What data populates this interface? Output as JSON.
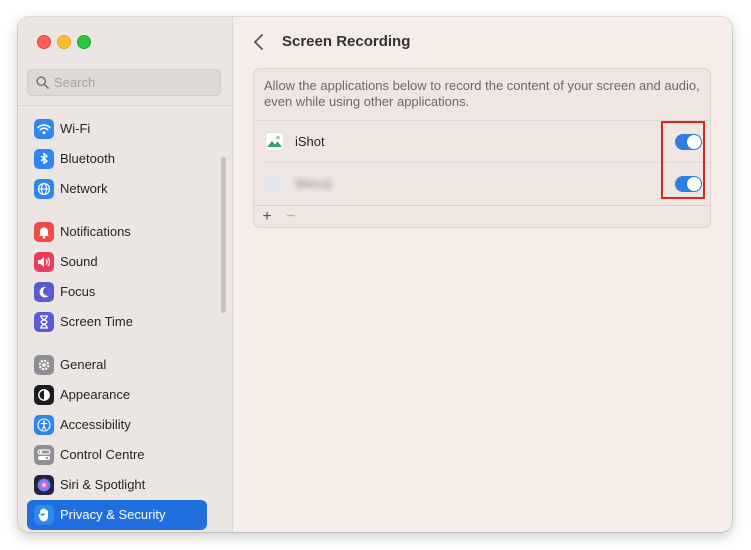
{
  "window": {
    "traffic_lights": [
      "close",
      "minimize",
      "maximize"
    ]
  },
  "search": {
    "placeholder": "Search"
  },
  "sidebar": {
    "items": [
      {
        "label": "Wi-Fi",
        "icon": "wifi-icon",
        "color": "#2f86ec"
      },
      {
        "label": "Bluetooth",
        "icon": "bluetooth-icon",
        "color": "#2f86ec"
      },
      {
        "label": "Network",
        "icon": "globe-icon",
        "color": "#2f86ec"
      },
      {
        "label": "Notifications",
        "icon": "bell-icon",
        "color": "#ef4a45"
      },
      {
        "label": "Sound",
        "icon": "speaker-icon",
        "color": "#ef3b5c"
      },
      {
        "label": "Focus",
        "icon": "moon-icon",
        "color": "#5b5bd6"
      },
      {
        "label": "Screen Time",
        "icon": "hourglass-icon",
        "color": "#5b5bd6"
      },
      {
        "label": "General",
        "icon": "gear-icon",
        "color": "#8e8e93"
      },
      {
        "label": "Appearance",
        "icon": "appearance-icon",
        "color": "#1c1c1e"
      },
      {
        "label": "Accessibility",
        "icon": "accessibility-icon",
        "color": "#2f86ec"
      },
      {
        "label": "Control Centre",
        "icon": "control-centre-icon",
        "color": "#8e8e93"
      },
      {
        "label": "Siri & Spotlight",
        "icon": "siri-icon",
        "color": "#6b3fa0"
      },
      {
        "label": "Privacy & Security",
        "icon": "hand-icon",
        "color": "#2f86ec",
        "active": true
      }
    ]
  },
  "header": {
    "title": "Screen Recording"
  },
  "panel": {
    "description": "Allow the applications below to record the content of your screen and audio, even while using other applications.",
    "apps": [
      {
        "name": "iShot",
        "enabled": true
      },
      {
        "name": "Wecut",
        "enabled": true,
        "blurred": true
      }
    ],
    "add_label": "+",
    "remove_label": "−"
  },
  "colors": {
    "accent": "#1f6fe0",
    "toggle_on": "#2f7fe0",
    "highlight": "#e32222"
  }
}
